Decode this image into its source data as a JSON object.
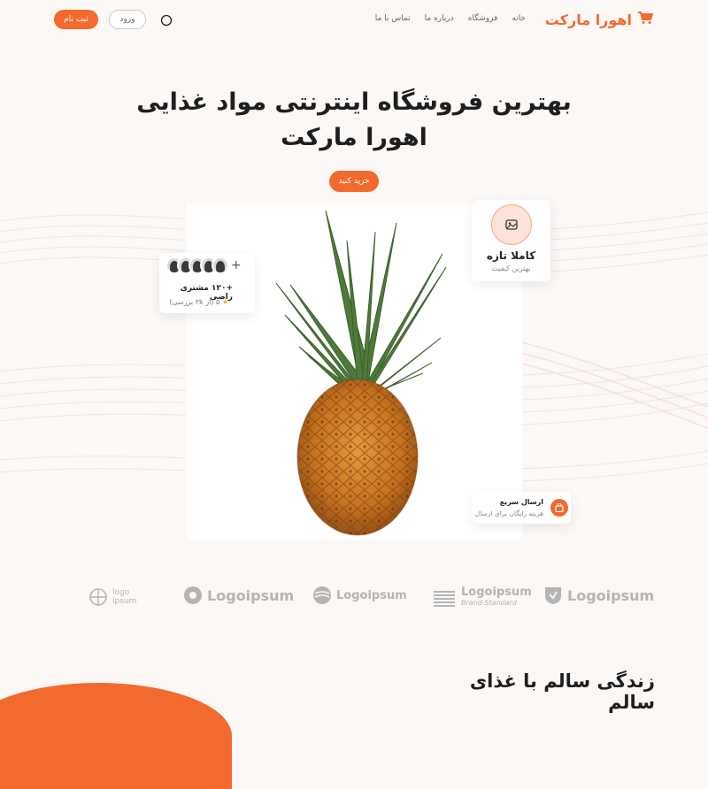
{
  "header": {
    "logo_text": "اهورا مارکت",
    "nav": [
      "خانه",
      "فروشگاه",
      "درباره ما",
      "تماس با ما"
    ],
    "login_label": "ورود",
    "signup_label": "ثبت نام"
  },
  "hero": {
    "title_line1": "بهترین فروشگاه اینترنتی مواد غذایی",
    "title_line2": "اهورا مارکت",
    "buy_label": "خرید کنید"
  },
  "cards": {
    "fresh": {
      "title": "کاملا تازه",
      "subtitle": "بهترین کیفیت"
    },
    "customers": {
      "count": "+۱۲۰ مشتری راضی",
      "rating": "۵ (از ۳k بررسی)"
    },
    "shipping": {
      "title": "ارسال سریع",
      "subtitle": "هزینه رایگان برای ارسال"
    }
  },
  "logos": [
    "logo ipsum",
    "Logoipsum",
    "Logoipsum",
    "Logoipsum",
    "Brand Standard",
    "Logoipsum"
  ],
  "section": {
    "title": "زندگی سالم با غذای سالم"
  },
  "colors": {
    "accent": "#f36a2e",
    "background": "#fbf8f6"
  }
}
